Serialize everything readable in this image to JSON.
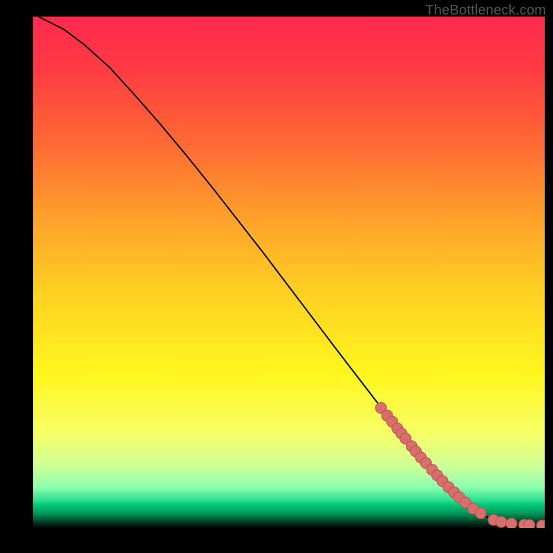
{
  "watermark": "TheBottleneck.com",
  "chart_data": {
    "type": "line",
    "title": "",
    "xlabel": "",
    "ylabel": "",
    "xlim": [
      0,
      100
    ],
    "ylim": [
      0,
      100
    ],
    "grid": false,
    "gradient_stops": [
      {
        "offset": 0.0,
        "color": "#ff2a4d"
      },
      {
        "offset": 0.1,
        "color": "#ff3a42"
      },
      {
        "offset": 0.25,
        "color": "#ff6a33"
      },
      {
        "offset": 0.4,
        "color": "#ffa32a"
      },
      {
        "offset": 0.55,
        "color": "#ffd322"
      },
      {
        "offset": 0.7,
        "color": "#fff71e"
      },
      {
        "offset": 0.82,
        "color": "#f6ff6a"
      },
      {
        "offset": 0.88,
        "color": "#ccff99"
      },
      {
        "offset": 0.92,
        "color": "#8cffb0"
      },
      {
        "offset": 0.945,
        "color": "#2fe08c"
      },
      {
        "offset": 0.955,
        "color": "#00c878"
      },
      {
        "offset": 0.97,
        "color": "#009c5e"
      },
      {
        "offset": 1.0,
        "color": "#000000"
      }
    ],
    "series": [
      {
        "name": "curve",
        "stroke": "#000000",
        "x": [
          1,
          3,
          6,
          10,
          15,
          20,
          25,
          30,
          35,
          40,
          45,
          50,
          55,
          60,
          65,
          70,
          72,
          75,
          78,
          80,
          83,
          86,
          88,
          90,
          92,
          95,
          98,
          100
        ],
        "y": [
          100,
          99,
          97.5,
          94.5,
          90,
          84.5,
          78.8,
          72.8,
          66.6,
          60.2,
          53.8,
          47.2,
          40.6,
          34.0,
          27.5,
          21.0,
          18.5,
          14.8,
          11.4,
          9.2,
          6.3,
          3.8,
          2.5,
          1.6,
          1.1,
          0.7,
          0.55,
          0.5
        ]
      }
    ],
    "markers": {
      "fill": "#d86f6c",
      "stroke": "#b8504f",
      "points": [
        {
          "x": 68.0,
          "y": 23.5
        },
        {
          "x": 69.2,
          "y": 22.0
        },
        {
          "x": 70.2,
          "y": 20.8
        },
        {
          "x": 71.2,
          "y": 19.5
        },
        {
          "x": 72.0,
          "y": 18.5
        },
        {
          "x": 72.8,
          "y": 17.5
        },
        {
          "x": 74.0,
          "y": 16.0
        },
        {
          "x": 74.8,
          "y": 15.0
        },
        {
          "x": 75.8,
          "y": 13.8
        },
        {
          "x": 76.8,
          "y": 12.7
        },
        {
          "x": 78.0,
          "y": 11.4
        },
        {
          "x": 79.0,
          "y": 10.3
        },
        {
          "x": 80.0,
          "y": 9.2
        },
        {
          "x": 81.2,
          "y": 8.0
        },
        {
          "x": 82.3,
          "y": 7.0
        },
        {
          "x": 83.3,
          "y": 6.0
        },
        {
          "x": 84.5,
          "y": 5.0
        },
        {
          "x": 86.0,
          "y": 3.8
        },
        {
          "x": 87.5,
          "y": 2.9
        },
        {
          "x": 90.0,
          "y": 1.6
        },
        {
          "x": 91.5,
          "y": 1.2
        },
        {
          "x": 93.5,
          "y": 0.9
        },
        {
          "x": 96.0,
          "y": 0.65
        },
        {
          "x": 97.0,
          "y": 0.6
        },
        {
          "x": 99.5,
          "y": 0.5
        }
      ]
    }
  }
}
